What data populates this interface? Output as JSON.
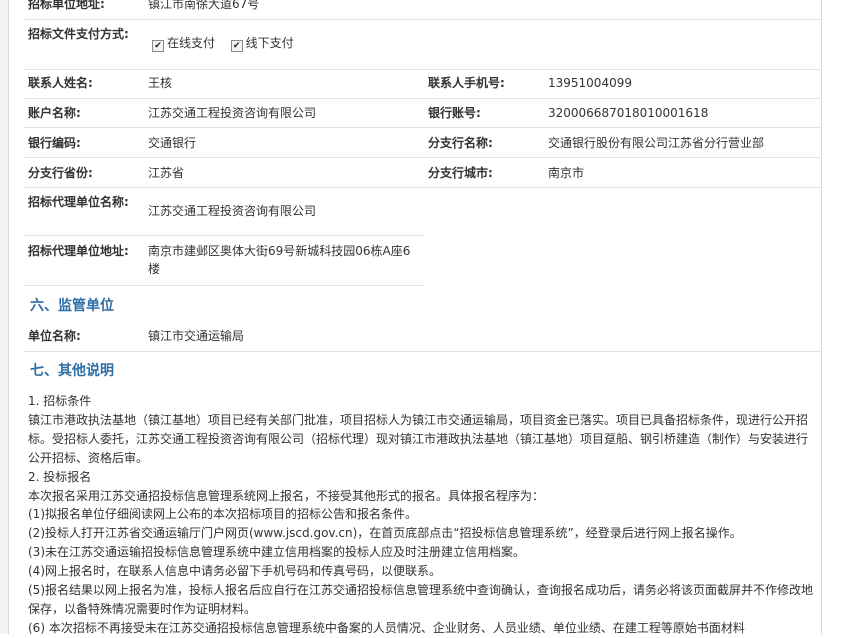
{
  "rows": {
    "address": {
      "label": "招标单位地址:",
      "value": "镇江市南徐大道67号"
    },
    "payment": {
      "label": "招标文件支付方式:",
      "online": "在线支付",
      "offline": "线下支付"
    },
    "contact": {
      "name_label": "联系人姓名:",
      "name": "王核",
      "phone_label": "联系人手机号:",
      "phone": "13951004099"
    },
    "account": {
      "name_label": "账户名称:",
      "name": "江苏交通工程投资咨询有限公司",
      "no_label": "银行账号:",
      "no": "32000668701801000161​8"
    },
    "bank": {
      "code_label": "银行编码:",
      "code": "交通银行",
      "branch_label": "分支行名称:",
      "branch": "交通银行股份有限公司江苏省分行营业部"
    },
    "branch_loc": {
      "province_label": "分支行省份:",
      "province": "江苏省",
      "city_label": "分支行城市:",
      "city": "南京市"
    },
    "agency": {
      "label": "招标代理单位名称:",
      "value": "江苏交通工程投资咨询有限公司"
    },
    "agency_addr": {
      "label": "招标代理单位地址:",
      "value": "南京市建邺区奥体大街69号新城科技园06栋A座6楼"
    }
  },
  "sections": {
    "supervision_title": "六、监管单位",
    "supervision_label": "单位名称:",
    "supervision_value": "镇江市交通运输局",
    "other_title": "七、其他说明"
  },
  "notes": [
    "1. 招标条件",
    "镇江市港政执法基地（镇江基地）项目已经有关部门批准，项目招标人为镇江市交通运输局，项目资金已落实。项目已具备招标条件，现进行公开招标。受招标人委托，江苏交通工程投资咨询有限公司（招标代理）现对镇江市港政执法基地（镇江基地）项目趸船、钢引桥建造（制作）与安装进行公开招标、资格后审。",
    "2. 投标报名",
    "本次报名采用江苏交通招投标信息管理系统网上报名，不接受其他形式的报名。具体报名程序为：",
    "(1)拟报名单位仔细阅读网上公布的本次招标项目的招标公告和报名条件。",
    "(2)投标人打开江苏省交通运输厅门户网页(www.jscd.gov.cn)，在首页底部点击“招投标信息管理系统”，经登录后进行网上报名操作。",
    "(3)未在江苏交通运输招投标信息管理系统中建立信用档案的投标人应及时注册建立信用档案。",
    "(4)网上报名时，在联系人信息中请务必留下手机号码和传真号码，以便联系。",
    "(5)报名结果以网上报名为准，投标人报名后应自行在江苏交通招投标信息管理系统中查询确认，查询报名成功后，请务必将该页面截屏并不作修改地保存，以备特殊情况需要时作为证明材料。",
    "(6) 本次招标不再接受未在江苏交通招投标信息管理系统中备案的人员情况、企业财务、人员业绩、单位业绩、在建工程等原始书面材料"
  ]
}
